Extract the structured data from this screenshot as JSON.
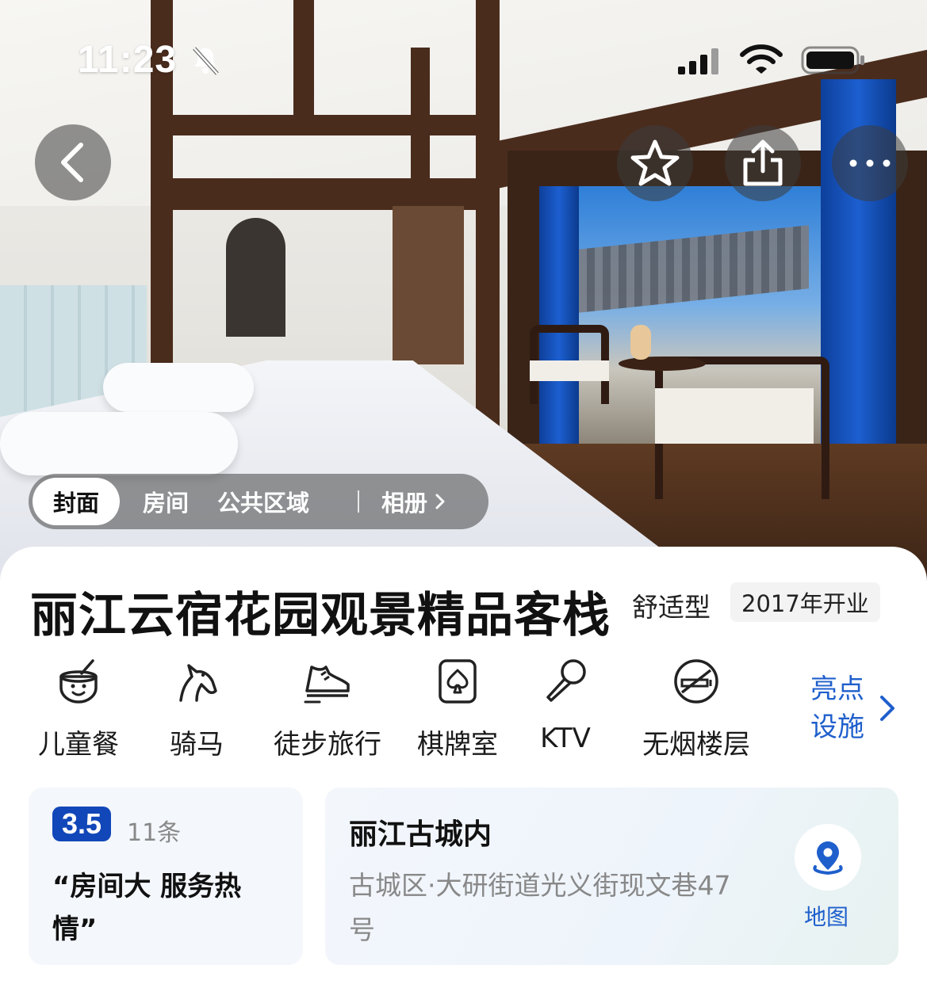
{
  "status_bar": {
    "time": "11:23"
  },
  "photo_tabs": {
    "items": [
      "封面",
      "房间",
      "公共区域"
    ],
    "album": "相册"
  },
  "hotel": {
    "name": "丽江云宿花园观景精品客栈",
    "type": "舒适型",
    "opened": "2017年开业"
  },
  "facilities": [
    {
      "label": "儿童餐",
      "icon": "kids-meal-icon"
    },
    {
      "label": "骑马",
      "icon": "horse-icon"
    },
    {
      "label": "徒步旅行",
      "icon": "sneaker-icon"
    },
    {
      "label": "棋牌室",
      "icon": "spade-card-icon"
    },
    {
      "label": "KTV",
      "icon": "microphone-icon"
    },
    {
      "label": "无烟楼层",
      "icon": "no-smoking-icon"
    }
  ],
  "facility_more": "亮点设施",
  "review": {
    "score": "3.5",
    "count": "11条",
    "quote": "“房间大 服务热情”"
  },
  "location": {
    "title": "丽江古城内",
    "address": "古城区·大研街道光义街现文巷47号",
    "map_label": "地图"
  },
  "colors": {
    "accent_blue": "#1f5fcc",
    "score_badge": "#1147b8"
  }
}
